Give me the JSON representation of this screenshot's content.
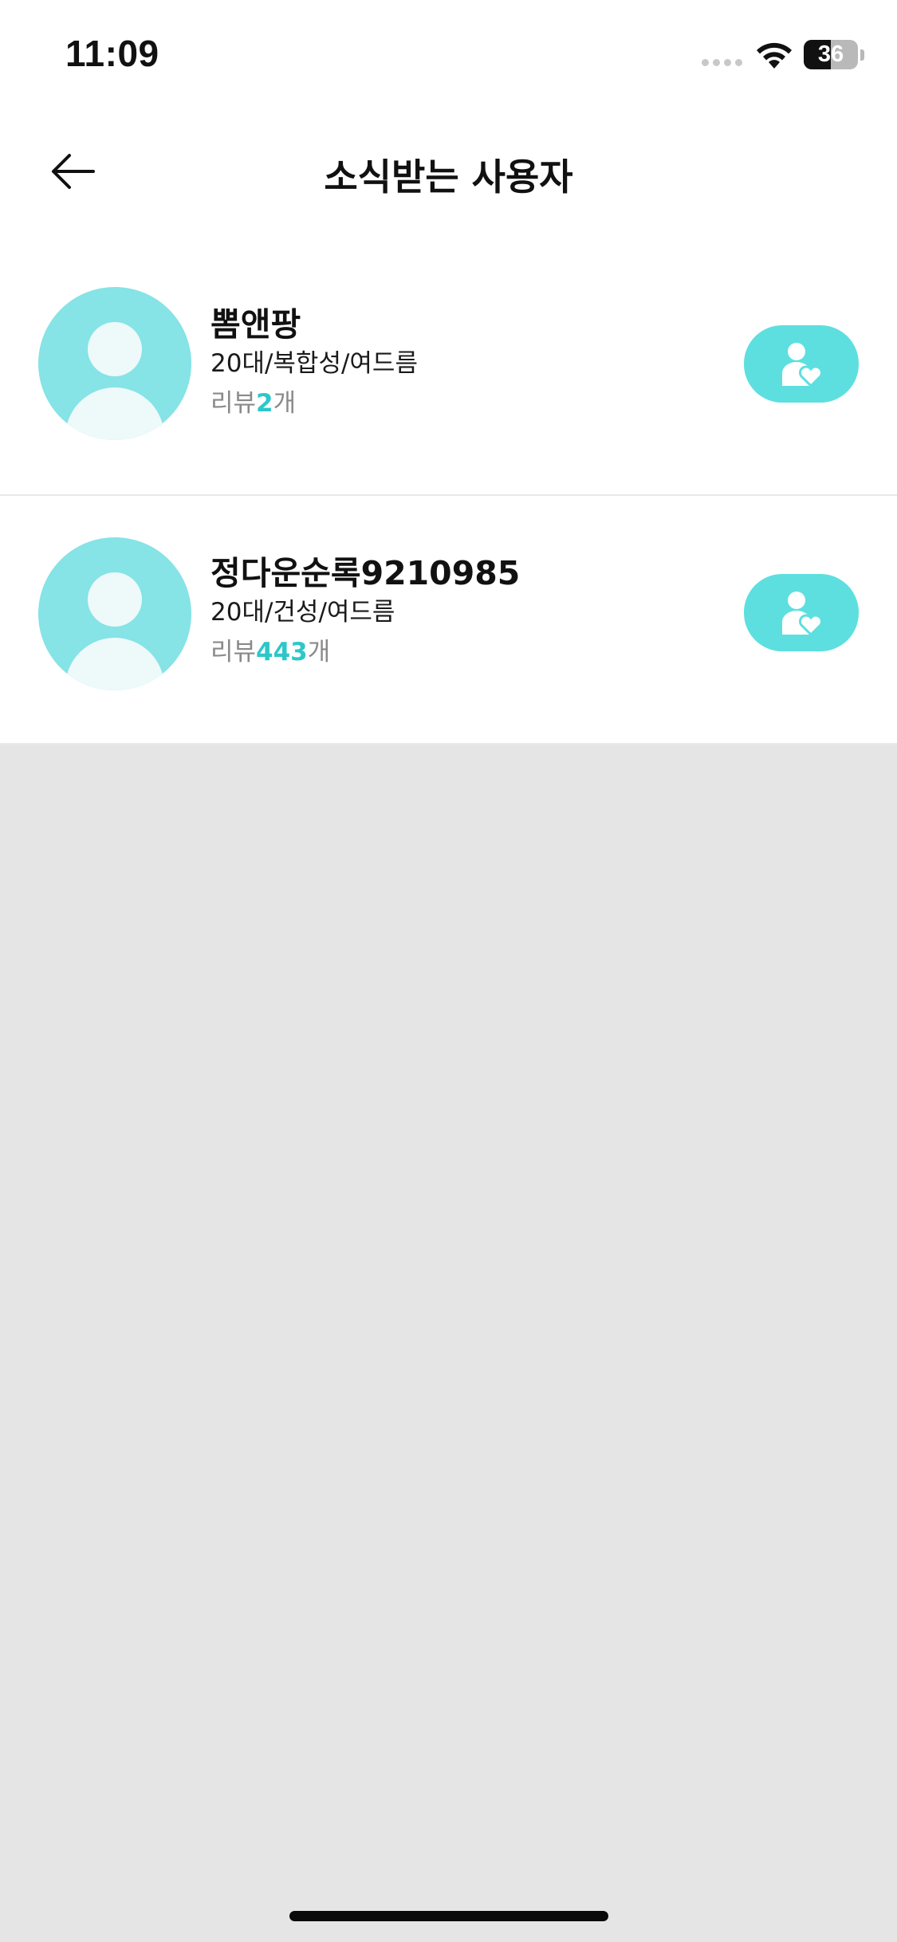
{
  "status_bar": {
    "time": "11:09",
    "battery_level": "36"
  },
  "nav": {
    "back_icon": "arrow-left-icon",
    "title": "소식받는 사용자"
  },
  "users": [
    {
      "name": "뽐앤팡",
      "meta": "20대/복합성/여드름",
      "reviews_prefix": "리뷰",
      "reviews_count": "2",
      "reviews_suffix": "개",
      "avatar_icon": "default-avatar-icon",
      "follow_icon": "person-heart-icon"
    },
    {
      "name": "정다운순록9210985",
      "meta": "20대/건성/여드름",
      "reviews_prefix": "리뷰",
      "reviews_count": "443",
      "reviews_suffix": "개",
      "avatar_icon": "default-avatar-icon",
      "follow_icon": "person-heart-icon"
    }
  ],
  "colors": {
    "accent": "#5ddfe0",
    "avatar_bg": "#86e3e6",
    "count_text": "#2cc7c9",
    "empty_area_bg": "#e5e5e6"
  }
}
